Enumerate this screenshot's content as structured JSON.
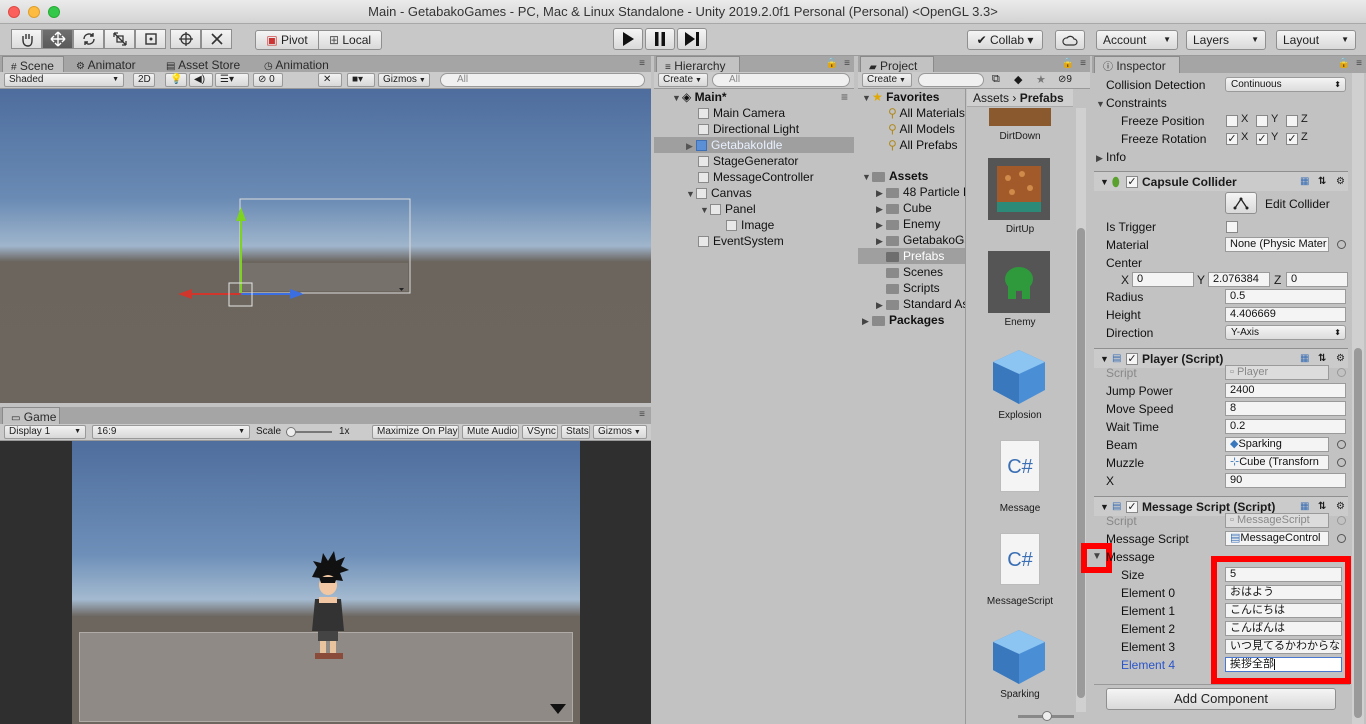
{
  "window": {
    "title": "Main - GetabakoGames - PC, Mac & Linux Standalone - Unity 2019.2.0f1 Personal (Personal) <OpenGL 3.3>"
  },
  "toolbar": {
    "pivot": "Pivot",
    "local": "Local",
    "collab": "Collab ▾",
    "account": "Account",
    "layers": "Layers",
    "layout": "Layout"
  },
  "scene": {
    "tabs": [
      "Scene",
      "Animator",
      "Asset Store",
      "Animation"
    ],
    "shading": "Shaded",
    "mode2d": "2D",
    "fx_count": "0",
    "gizmos": "Gizmos",
    "search_placeholder": "All"
  },
  "game": {
    "tab": "Game",
    "display": "Display 1",
    "aspect": "16:9",
    "scale_label": "Scale",
    "scale_value": "1x",
    "options": [
      "Maximize On Play",
      "Mute Audio",
      "VSync",
      "Stats",
      "Gizmos"
    ]
  },
  "hierarchy": {
    "tab": "Hierarchy",
    "create": "Create",
    "search_placeholder": "All",
    "scene": "Main*",
    "items": [
      "Main Camera",
      "Directional Light",
      "GetabakoIdle",
      "StageGenerator",
      "MessageController",
      "Canvas",
      "Panel",
      "Image",
      "EventSystem"
    ]
  },
  "project": {
    "tab": "Project",
    "create": "Create",
    "favorites": "Favorites",
    "favorites_items": [
      "All Materials",
      "All Models",
      "All Prefabs"
    ],
    "assets_label": "Assets",
    "folders": [
      "48 Particle E",
      "Cube",
      "Enemy",
      "GetabakoGa",
      "Prefabs",
      "Scenes",
      "Scripts",
      "Standard As"
    ],
    "packages": "Packages",
    "breadcrumb": [
      "Assets",
      "Prefabs"
    ],
    "count": "9",
    "asset_items": [
      "DirtDown",
      "DirtUp",
      "Enemy",
      "Explosion",
      "Message",
      "MessageScript",
      "Sparking"
    ],
    "csharp": "C#"
  },
  "inspector": {
    "tab": "Inspector",
    "rigidbody": {
      "collision_label": "Collision Detection",
      "collision_value": "Continuous",
      "constraints": "Constraints",
      "freeze_position": "Freeze Position",
      "freeze_rotation": "Freeze Rotation",
      "axes": [
        "X",
        "Y",
        "Z"
      ],
      "info": "Info"
    },
    "capsule": {
      "title": "Capsule Collider",
      "edit": "Edit Collider",
      "is_trigger": "Is Trigger",
      "material_label": "Material",
      "material_value": "None (Physic Mater",
      "center": "Center",
      "cx": "0",
      "cy": "2.076384",
      "cz": "0",
      "radius_label": "Radius",
      "radius": "0.5",
      "height_label": "Height",
      "height": "4.406669",
      "direction_label": "Direction",
      "direction": "Y-Axis"
    },
    "player": {
      "title": "Player (Script)",
      "script_label": "Script",
      "script": "Player",
      "jump_label": "Jump Power",
      "jump": "2400",
      "move_label": "Move Speed",
      "move": "8",
      "wait_label": "Wait Time",
      "wait": "0.2",
      "beam_label": "Beam",
      "beam": "Sparking",
      "muzzle_label": "Muzzle",
      "muzzle": "Cube (Transforn",
      "x_label": "X",
      "x": "90"
    },
    "message": {
      "title": "Message Script (Script)",
      "script_label": "Script",
      "script": "MessageScript",
      "ms_label": "Message Script",
      "ms": "MessageControl",
      "message_label": "Message",
      "size_label": "Size",
      "size": "5",
      "elements": [
        {
          "label": "Element 0",
          "value": "おはよう"
        },
        {
          "label": "Element 1",
          "value": "こんにちは"
        },
        {
          "label": "Element 2",
          "value": "こんばんは"
        },
        {
          "label": "Element 3",
          "value": "いつ見てるかわからない"
        },
        {
          "label": "Element 4",
          "value": "挨拶全部"
        }
      ]
    },
    "add_component": "Add Component"
  }
}
